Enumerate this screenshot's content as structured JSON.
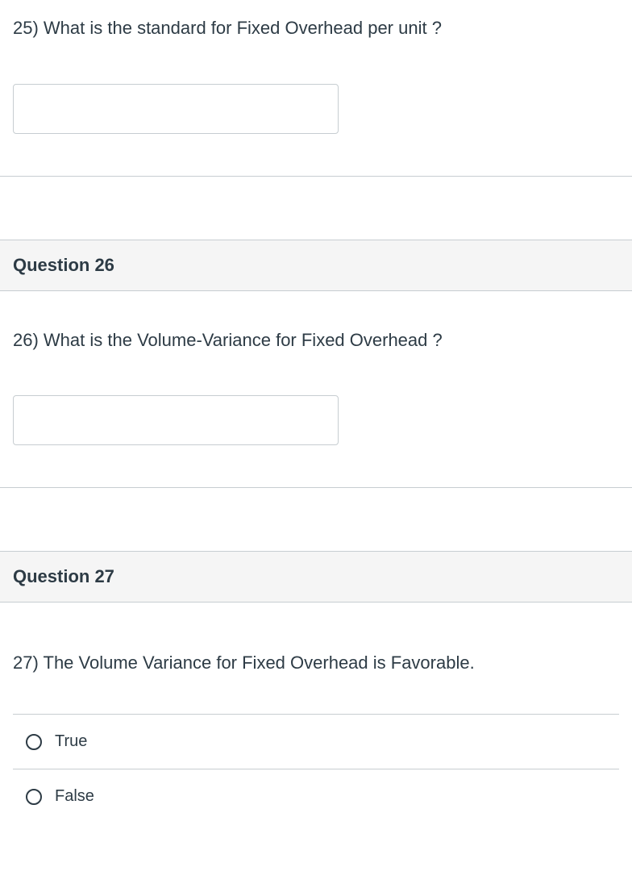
{
  "q25": {
    "text": "25) What is the standard for Fixed Overhead per unit ?",
    "value": ""
  },
  "q26": {
    "header": "Question 26",
    "text": "26) What is the Volume-Variance for Fixed Overhead ?",
    "value": ""
  },
  "q27": {
    "header": "Question 27",
    "text": "27) The Volume Variance for Fixed Overhead is Favorable.",
    "options": [
      {
        "label": "True"
      },
      {
        "label": "False"
      }
    ]
  }
}
